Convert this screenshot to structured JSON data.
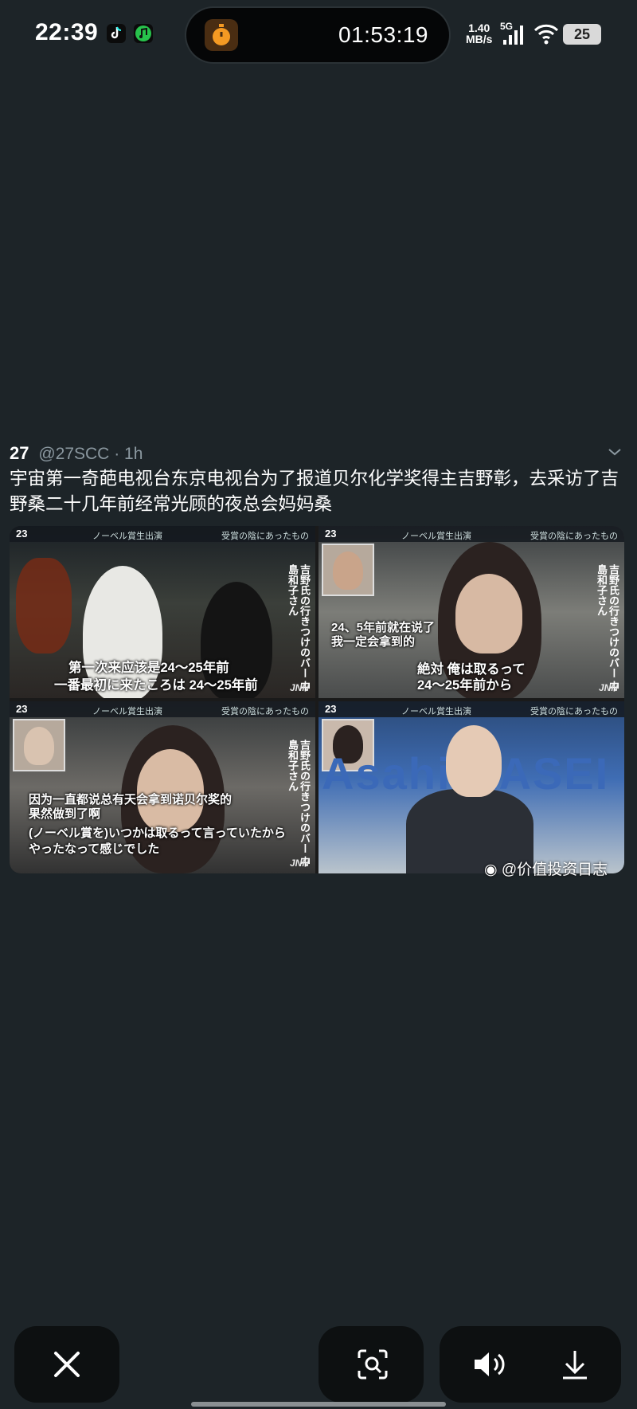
{
  "status_bar": {
    "time": "22:39",
    "island_timer": "01:53:19",
    "net_speed_value": "1.40",
    "net_speed_unit": "MB/s",
    "signal_label": "5G",
    "battery_level": "25",
    "icons": [
      "tiktok-icon",
      "music-icon",
      "timer-icon",
      "signal-icon",
      "wifi-icon",
      "battery-icon"
    ]
  },
  "tweet": {
    "name": "27",
    "handle": "@27SCC",
    "time_ago": "1h",
    "text": "宇宙第一奇葩电视台东京电视台为了报道贝尔化学奖得主吉野彰，去采访了吉野桑二十几年前经常光顾的夜总会妈妈桑"
  },
  "media": {
    "ticker_program": "23",
    "ticker_left": "ノーベル賞生出演",
    "ticker_right": "受賞の陰にあったもの",
    "name_label": "吉野氏の行きつけのバー 中島和子さん",
    "network": "JNN",
    "frame1_caption_cn": "第一次来应该是24～25年前",
    "frame1_caption_jp": "一番最初に来たころは 24～25年前",
    "frame2_caption_cn_line1": "24、5年前就在说了",
    "frame2_caption_cn_line2": "我一定会拿到的",
    "frame2_caption_jp_line1": "絶対 俺は取るって",
    "frame2_caption_jp_line2": "24～25年前から",
    "frame3_caption_cn_line1": "因为一直都说总有天会拿到诺贝尔奖的",
    "frame3_caption_cn_line2": "果然做到了啊",
    "frame3_caption_jp_line1": "(ノーベル賞を)いつかは取るって言っていたから",
    "frame3_caption_jp_line2": "やったなって感じでした",
    "frame4_sign": "Asahi KASEI",
    "watermark": "@价值投资日志"
  },
  "bottom_bar": {
    "buttons": [
      "close-icon",
      "scan-icon",
      "volume-icon",
      "download-icon"
    ]
  }
}
